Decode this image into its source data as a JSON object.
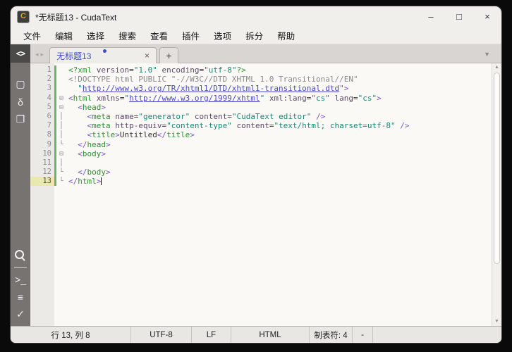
{
  "colors": {
    "accent": "#3a4fc2",
    "tag": "#2f8f33",
    "punct": "#7a55c8",
    "attr": "#5d4968",
    "value": "#1b8577",
    "url": "#4848cc",
    "gray": "#8a8a8a",
    "strip": "#6faf6f"
  },
  "window": {
    "title": "*无标题13 - CudaText",
    "app_icon_letter": "C"
  },
  "controls": {
    "minimize": "–",
    "maximize": "□",
    "close": "×"
  },
  "menu": {
    "items": [
      {
        "id": "file",
        "label": "文件"
      },
      {
        "id": "edit",
        "label": "编辑"
      },
      {
        "id": "selection",
        "label": "选择"
      },
      {
        "id": "search",
        "label": "搜索"
      },
      {
        "id": "view",
        "label": "查看"
      },
      {
        "id": "plugins",
        "label": "插件"
      },
      {
        "id": "options",
        "label": "选项"
      },
      {
        "id": "split",
        "label": "拆分"
      },
      {
        "id": "help",
        "label": "帮助"
      }
    ]
  },
  "tabs": {
    "nav_prev": "◂",
    "nav_next": "▸",
    "active": {
      "label": "无标题13",
      "modified": true
    },
    "close_glyph": "×",
    "new_label": "+",
    "menu_glyph": "▼"
  },
  "activity_bar": {
    "top": {
      "name": "code-sidebar-toggle",
      "glyph": "<>"
    },
    "middle": [
      {
        "name": "package",
        "glyph": "▢"
      },
      {
        "name": "delta-snippets",
        "glyph": "δ"
      },
      {
        "name": "folder",
        "glyph": "❐"
      }
    ],
    "bottom": [
      {
        "name": "search",
        "glyph": "",
        "magnifier": true
      },
      {
        "name": "console",
        "glyph": ">_"
      },
      {
        "name": "output-list",
        "glyph": "≡"
      },
      {
        "name": "validate-check",
        "glyph": "✓"
      }
    ]
  },
  "editor": {
    "current_line": 13,
    "caret": {
      "line": 13,
      "col": 8
    },
    "lines": [
      {
        "n": 1,
        "fold": "",
        "seg": [
          [
            "tg",
            "<?xml"
          ],
          [
            "tx",
            " "
          ],
          [
            "at",
            "version"
          ],
          [
            "tx",
            "="
          ],
          [
            "vl",
            "\"1.0\""
          ],
          [
            "tx",
            " "
          ],
          [
            "at",
            "encoding"
          ],
          [
            "tx",
            "="
          ],
          [
            "vl",
            "\"utf-8\""
          ],
          [
            "tg",
            "?>"
          ]
        ]
      },
      {
        "n": 2,
        "fold": "",
        "seg": [
          [
            "gr",
            "<!DOCTYPE html PUBLIC \"-//W3C//DTD XHTML 1.0 Transitional//EN\""
          ]
        ]
      },
      {
        "n": 3,
        "fold": "",
        "seg": [
          [
            "tx",
            "  "
          ],
          [
            "vl",
            "\""
          ],
          [
            "ur",
            "http://www.w3.org/TR/xhtml1/DTD/xhtml1-transitional.dtd"
          ],
          [
            "vl",
            "\""
          ],
          [
            "pu",
            ">"
          ]
        ]
      },
      {
        "n": 4,
        "fold": "⊟",
        "seg": [
          [
            "pu",
            "<"
          ],
          [
            "tg",
            "html"
          ],
          [
            "tx",
            " "
          ],
          [
            "at",
            "xmlns"
          ],
          [
            "tx",
            "="
          ],
          [
            "vl",
            "\""
          ],
          [
            "ur",
            "http://www.w3.org/1999/xhtml"
          ],
          [
            "vl",
            "\""
          ],
          [
            "tx",
            " "
          ],
          [
            "at",
            "xml:lang"
          ],
          [
            "tx",
            "="
          ],
          [
            "vl",
            "\"cs\""
          ],
          [
            "tx",
            " "
          ],
          [
            "at",
            "lang"
          ],
          [
            "tx",
            "="
          ],
          [
            "vl",
            "\"cs\""
          ],
          [
            "pu",
            ">"
          ]
        ]
      },
      {
        "n": 5,
        "fold": "⊟",
        "seg": [
          [
            "tx",
            "  "
          ],
          [
            "pu",
            "<"
          ],
          [
            "tg",
            "head"
          ],
          [
            "pu",
            ">"
          ]
        ]
      },
      {
        "n": 6,
        "fold": "│",
        "seg": [
          [
            "tx",
            "    "
          ],
          [
            "pu",
            "<"
          ],
          [
            "tg",
            "meta"
          ],
          [
            "tx",
            " "
          ],
          [
            "at",
            "name"
          ],
          [
            "tx",
            "="
          ],
          [
            "vl",
            "\"generator\""
          ],
          [
            "tx",
            " "
          ],
          [
            "at",
            "content"
          ],
          [
            "tx",
            "="
          ],
          [
            "vl",
            "\"CudaText editor\""
          ],
          [
            "tx",
            " "
          ],
          [
            "pu",
            "/>"
          ]
        ]
      },
      {
        "n": 7,
        "fold": "│",
        "seg": [
          [
            "tx",
            "    "
          ],
          [
            "pu",
            "<"
          ],
          [
            "tg",
            "meta"
          ],
          [
            "tx",
            " "
          ],
          [
            "at",
            "http-equiv"
          ],
          [
            "tx",
            "="
          ],
          [
            "vl",
            "\"content-type\""
          ],
          [
            "tx",
            " "
          ],
          [
            "at",
            "content"
          ],
          [
            "tx",
            "="
          ],
          [
            "vl",
            "\"text/html; charset=utf-8\""
          ],
          [
            "tx",
            " "
          ],
          [
            "pu",
            "/>"
          ]
        ]
      },
      {
        "n": 8,
        "fold": "│",
        "seg": [
          [
            "tx",
            "    "
          ],
          [
            "pu",
            "<"
          ],
          [
            "tg",
            "title"
          ],
          [
            "pu",
            ">"
          ],
          [
            "tx",
            "Untitled"
          ],
          [
            "pu",
            "</"
          ],
          [
            "tg",
            "title"
          ],
          [
            "pu",
            ">"
          ]
        ]
      },
      {
        "n": 9,
        "fold": "└",
        "seg": [
          [
            "tx",
            "  "
          ],
          [
            "pu",
            "</"
          ],
          [
            "tg",
            "head"
          ],
          [
            "pu",
            ">"
          ]
        ]
      },
      {
        "n": 10,
        "fold": "⊟",
        "seg": [
          [
            "tx",
            "  "
          ],
          [
            "pu",
            "<"
          ],
          [
            "tg",
            "body"
          ],
          [
            "pu",
            ">"
          ]
        ]
      },
      {
        "n": 11,
        "fold": "│",
        "seg": []
      },
      {
        "n": 12,
        "fold": "└",
        "seg": [
          [
            "tx",
            "  "
          ],
          [
            "pu",
            "</"
          ],
          [
            "tg",
            "body"
          ],
          [
            "pu",
            ">"
          ]
        ]
      },
      {
        "n": 13,
        "fold": "└",
        "caret": true,
        "seg": [
          [
            "pu",
            "</"
          ],
          [
            "tg",
            "html"
          ],
          [
            "pu",
            ">"
          ]
        ]
      }
    ]
  },
  "scrollbar": {
    "up": "▲",
    "down": "▼"
  },
  "statusbar": {
    "cells": [
      {
        "name": "caret-pos",
        "label": "行 13, 列 8"
      },
      {
        "name": "encoding",
        "label": "UTF-8"
      },
      {
        "name": "line-ends",
        "label": "LF"
      },
      {
        "name": "lexer",
        "label": "HTML"
      },
      {
        "name": "tab-size",
        "label": "制表符: 4"
      },
      {
        "name": "wrap-mode",
        "label": "-"
      }
    ]
  }
}
